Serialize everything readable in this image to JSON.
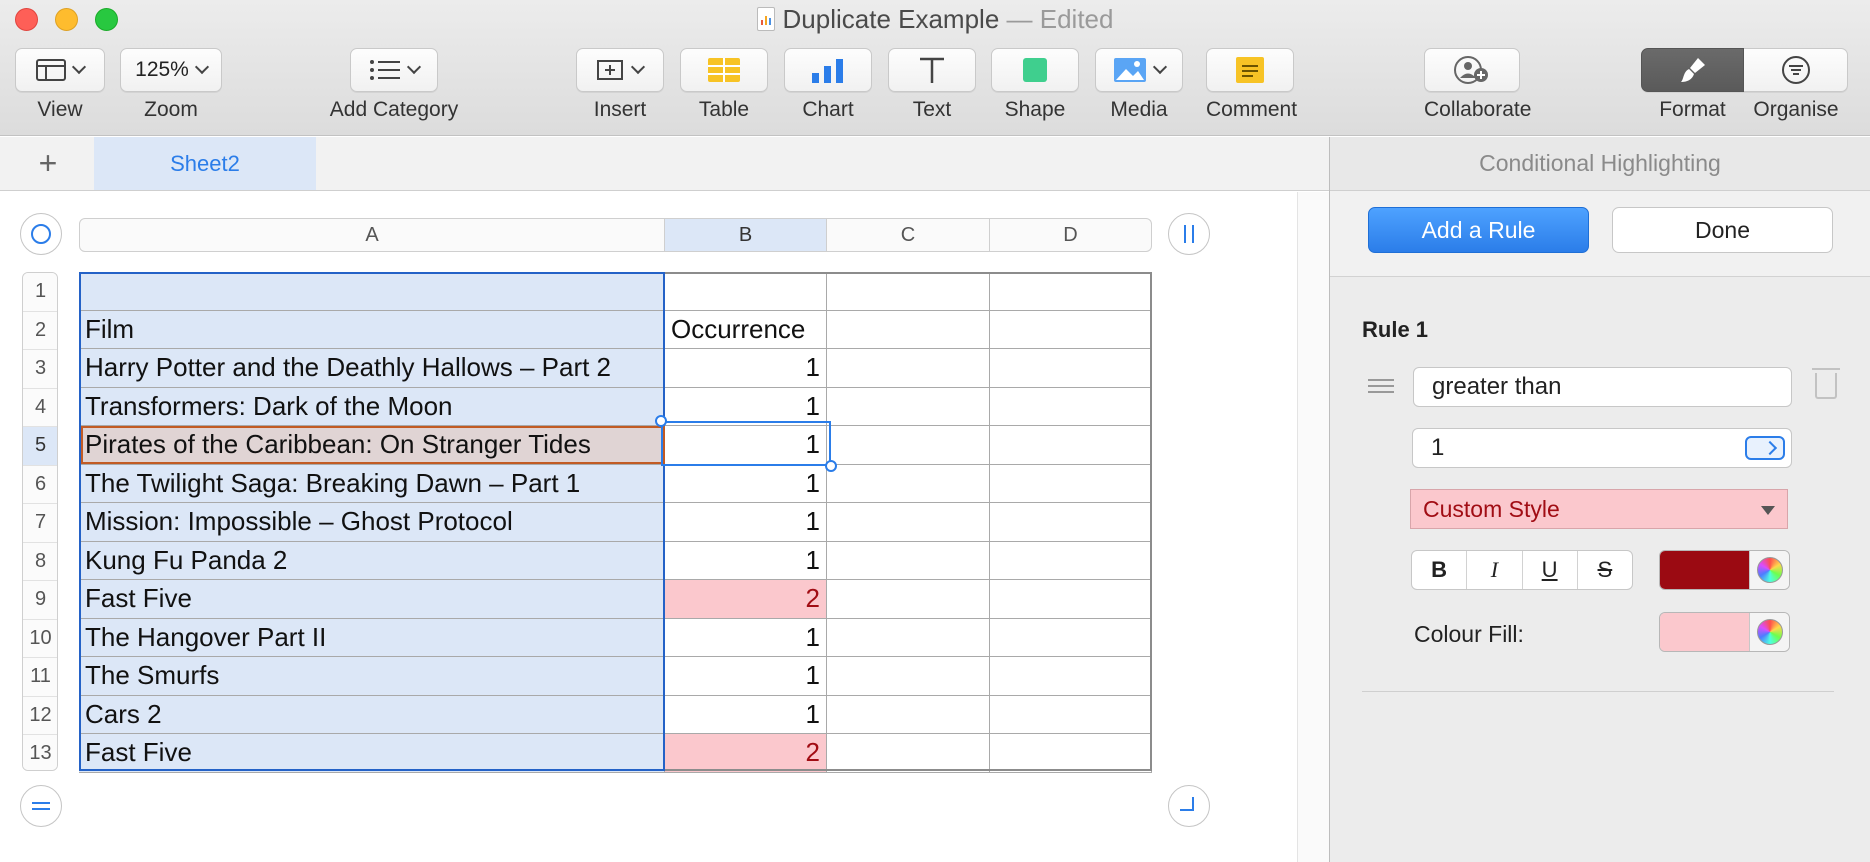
{
  "window": {
    "title": "Duplicate Example",
    "separator": " — ",
    "status": "Edited",
    "brand_color": "#2b7de9"
  },
  "toolbar": {
    "view": "View",
    "zoom_value": "125%",
    "zoom": "Zoom",
    "add_category": "Add Category",
    "insert": "Insert",
    "table": "Table",
    "chart": "Chart",
    "text": "Text",
    "shape": "Shape",
    "media": "Media",
    "comment": "Comment",
    "collaborate": "Collaborate",
    "format": "Format",
    "organise": "Organise"
  },
  "sheets": {
    "add_symbol": "+",
    "active": "Sheet2"
  },
  "spreadsheet": {
    "columns": [
      "A",
      "B",
      "C",
      "D"
    ],
    "selected_column": "B",
    "rows": [
      {
        "n": "1",
        "film": "",
        "occ": ""
      },
      {
        "n": "2",
        "film": "Film",
        "occ": "Occurrence"
      },
      {
        "n": "3",
        "film": "Harry Potter and the Deathly Hallows – Part 2",
        "occ": "1"
      },
      {
        "n": "4",
        "film": "Transformers: Dark of the Moon",
        "occ": "1"
      },
      {
        "n": "5",
        "film": "Pirates of the Caribbean: On Stranger Tides",
        "occ": "1"
      },
      {
        "n": "6",
        "film": "The Twilight Saga: Breaking Dawn – Part 1",
        "occ": "1"
      },
      {
        "n": "7",
        "film": "Mission: Impossible – Ghost Protocol",
        "occ": "1"
      },
      {
        "n": "8",
        "film": "Kung Fu Panda 2",
        "occ": "1"
      },
      {
        "n": "9",
        "film": "Fast Five",
        "occ": "2"
      },
      {
        "n": "10",
        "film": "The Hangover Part II",
        "occ": "1"
      },
      {
        "n": "11",
        "film": "The Smurfs",
        "occ": "1"
      },
      {
        "n": "12",
        "film": "Cars 2",
        "occ": "1"
      },
      {
        "n": "13",
        "film": "Fast Five",
        "occ": "2"
      }
    ],
    "active_row": "5",
    "highlight_fill": "#fbc8cd",
    "highlight_text": "#a10d14"
  },
  "inspector": {
    "title": "Conditional Highlighting",
    "add_rule": "Add a Rule",
    "done": "Done",
    "rule_title": "Rule 1",
    "condition": "greater than",
    "value": "1",
    "style": "Custom Style",
    "bold": "B",
    "italic": "I",
    "underline": "U",
    "strike": "S",
    "text_color": "#9b0a12",
    "fill_label": "Colour Fill:",
    "fill_color": "#fbc8cd"
  }
}
